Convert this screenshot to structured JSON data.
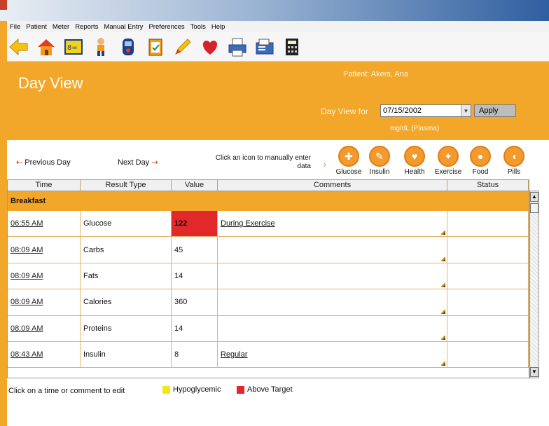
{
  "menu": [
    "File",
    "Patient",
    "Meter",
    "Reports",
    "Manual Entry",
    "Preferences",
    "Tools",
    "Help"
  ],
  "toolbar": {
    "icons": [
      "back-arrow-icon",
      "home-icon",
      "list-card-icon",
      "person-icon",
      "meter-icon",
      "clipboard-icon",
      "pencil-icon",
      "heart-icon",
      "printer-icon",
      "fax-icon",
      "calculator-icon"
    ]
  },
  "header": {
    "title": "Day View",
    "patient": "Patient: Akers, Ana",
    "day_view_for_label": "Day View for",
    "date_value": "07/15/2002",
    "apply_label": "Apply",
    "units": "mg/dL (Plasma)"
  },
  "nav": {
    "previous_label": "Previous Day",
    "next_label": "Next Day",
    "instruction": "Click an icon to manually enter data",
    "entry_items": [
      "Glucose",
      "Insulin",
      "Health",
      "Exercise",
      "Food",
      "Pills"
    ]
  },
  "table": {
    "headers": [
      "Time",
      "Result Type",
      "Value",
      "Comments",
      "Status"
    ],
    "group": "Breakfast",
    "rows": [
      {
        "time": "06:55 AM",
        "type": "Glucose",
        "value": "122",
        "comment": "During Exercise",
        "status": ""
      },
      {
        "time": "08:09 AM",
        "type": "Carbs",
        "value": "45",
        "comment": "",
        "status": ""
      },
      {
        "time": "08:09 AM",
        "type": "Fats",
        "value": "14",
        "comment": "",
        "status": ""
      },
      {
        "time": "08:09 AM",
        "type": "Calories",
        "value": "360",
        "comment": "",
        "status": ""
      },
      {
        "time": "08:09 AM",
        "type": "Proteins",
        "value": "14",
        "comment": "",
        "status": ""
      },
      {
        "time": "08:43 AM",
        "type": "Insulin",
        "value": "8",
        "comment": "Regular",
        "status": ""
      }
    ]
  },
  "footer": {
    "hint": "Click on a time or comment to edit",
    "legend": [
      {
        "label": "Hypoglycemic",
        "color": "#f5e61a"
      },
      {
        "label": "Above Target",
        "color": "#e3282c"
      }
    ]
  },
  "colors": {
    "accent": "#f3a72a",
    "above_target": "#e3282c"
  }
}
